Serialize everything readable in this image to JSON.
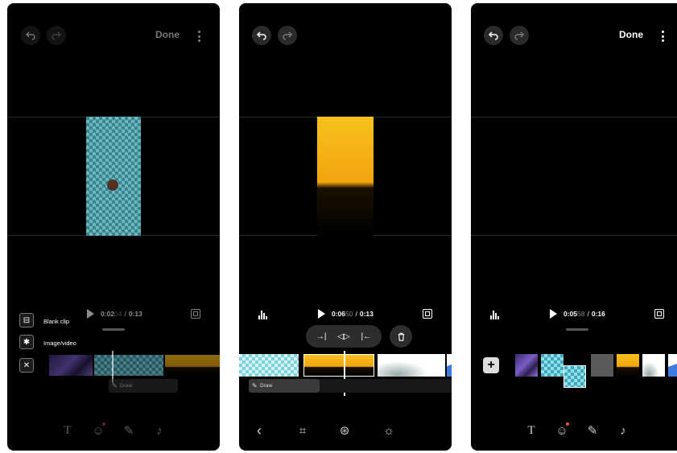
{
  "screen1": {
    "done_label": "Done",
    "time_current": "0:02",
    "time_fraction": "04",
    "time_total": "0:13",
    "time_separator": "/",
    "menu_items": [
      {
        "label": "Blank clip",
        "icon": "blank-clip-icon"
      },
      {
        "label": "Image/video",
        "icon": "gear-icon"
      },
      {
        "label": "",
        "icon": "close-icon"
      }
    ],
    "draw_track_label": "Draw",
    "bottom_tools": [
      "text-icon",
      "sticker-icon",
      "pen-icon",
      "music-icon"
    ]
  },
  "screen2": {
    "time_current": "0:06",
    "time_fraction": "50",
    "time_total": "0:13",
    "time_separator": "/",
    "draw_track_label": "Draw",
    "edit_actions": [
      "trim-start-icon",
      "split-icon",
      "trim-end-icon"
    ],
    "bottom_tools": [
      "back-icon",
      "crop-icon",
      "filter-icon",
      "brightness-icon"
    ]
  },
  "screen3": {
    "done_label": "Done",
    "time_current": "0:05",
    "time_fraction": "58",
    "time_total": "0:16",
    "time_separator": "/",
    "add_label": "+",
    "bottom_tools": [
      "text-icon",
      "sticker-icon",
      "pen-icon",
      "music-icon"
    ]
  },
  "colors": {
    "background": "#000000",
    "accent_dot": "#e0552a",
    "checker_teal": "#3fa7b8",
    "flower_yellow": "#f7c21c"
  }
}
